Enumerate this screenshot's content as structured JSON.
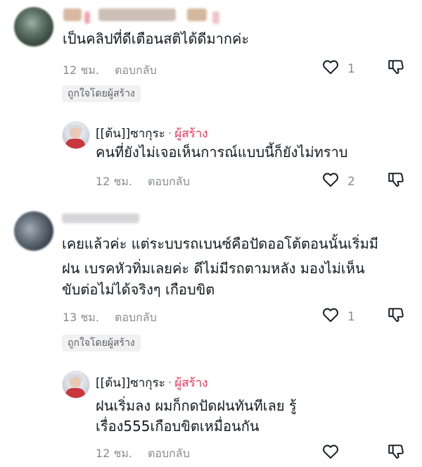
{
  "comments": [
    {
      "text": "เป็นคลิปที่ดีเตือนสติได้ดีมากค่ะ",
      "time": "12 ชม.",
      "reply_label": "ตอบกลับ",
      "likes": "1",
      "creator_badge": "ถูกใจโดยผู้สร้าง",
      "reply": {
        "name": "[[ต้น]]ซากุระ",
        "separator": "·",
        "creator_label": "ผู้สร้าง",
        "text": "คนที่ยังไม่เจอเห็นการณ์แบบนี้ก็ยังไม่ทราบ",
        "time": "12 ชม.",
        "reply_label": "ตอบกลับ",
        "likes": "2"
      }
    },
    {
      "text_lines": [
        "เคยแล้วค่ะ แต่ระบบรถเบนซ์คือปัดออโต้ตอนนั้นเริ่มมี",
        "ฝน เบรคหัวทิ่มเลยค่ะ ดีไม่มีรถตามหลัง มองไม่เห็น",
        "ขับต่อไม่ได้จริงๆ เกือบขิต"
      ],
      "time": "13 ชม.",
      "reply_label": "ตอบกลับ",
      "likes": "1",
      "creator_badge": "ถูกใจโดยผู้สร้าง",
      "reply": {
        "name": "[[ต้น]]ซากุระ",
        "separator": "·",
        "creator_label": "ผู้สร้าง",
        "text_lines": [
          "ฝนเริ่มลง ผมก็กดปัดฝนทันทีเลย รู้",
          "เรื่อง555เกือบขิตเหมื่อนกัน"
        ],
        "time": "12 ชม.",
        "reply_label": "ตอบกลับ"
      }
    }
  ],
  "icons": {
    "like": "heart-outline-icon",
    "dislike": "thumbs-down-icon"
  },
  "colors": {
    "creator_accent": "#fe2c55",
    "meta_gray": "#8a8b91",
    "badge_bg": "#f1f1f2"
  }
}
